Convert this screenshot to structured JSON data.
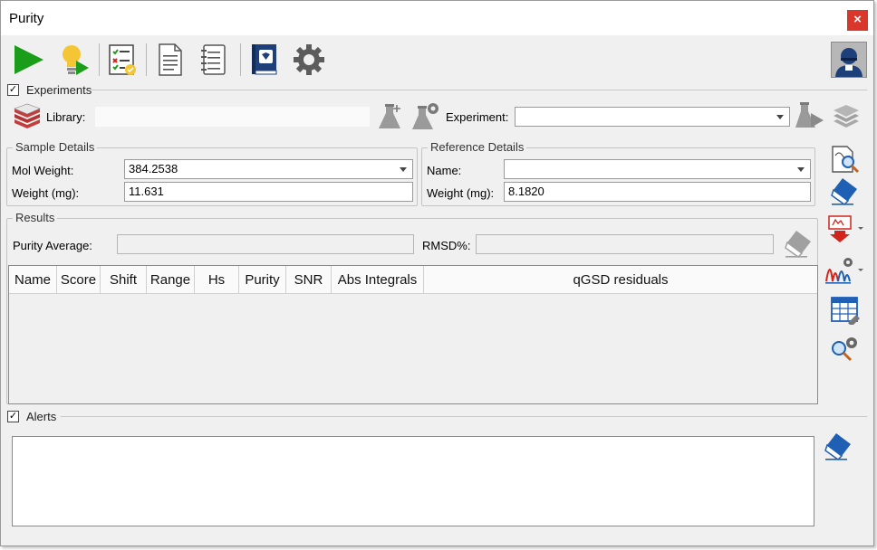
{
  "window": {
    "title": "Purity",
    "close_label": "×"
  },
  "toolbar": {
    "icons": [
      "play-icon",
      "lightbulb-play-icon",
      "checklist-icon",
      "document-icon",
      "notebook-icon",
      "book-icon",
      "gear-icon",
      "user-avatar-icon"
    ]
  },
  "experiments": {
    "label": "Experiments",
    "checked": true,
    "library_label": "Library:",
    "library_value": "",
    "experiment_label": "Experiment:",
    "experiment_value": ""
  },
  "sample_details": {
    "title": "Sample Details",
    "mol_weight_label": "Mol Weight:",
    "mol_weight_value": "384.2538",
    "weight_label": "Weight (mg):",
    "weight_value": "11.631"
  },
  "reference_details": {
    "title": "Reference Details",
    "name_label": "Name:",
    "name_value": "",
    "weight_label": "Weight (mg):",
    "weight_value": "8.1820"
  },
  "results": {
    "title": "Results",
    "purity_average_label": "Purity Average:",
    "purity_average_value": "",
    "rmsd_label": "RMSD%:",
    "rmsd_value": "",
    "columns": [
      "Name",
      "Score",
      "Shift",
      "Range",
      "Hs",
      "Purity",
      "SNR",
      "Abs Integrals",
      "qGSD residuals"
    ],
    "rows": []
  },
  "alerts": {
    "label": "Alerts",
    "checked": true,
    "text": ""
  },
  "colors": {
    "play_green": "#1a9e1a",
    "close_red": "#d9362c",
    "eraser_blue": "#1f5fb4",
    "arrow_red": "#d0241c"
  }
}
